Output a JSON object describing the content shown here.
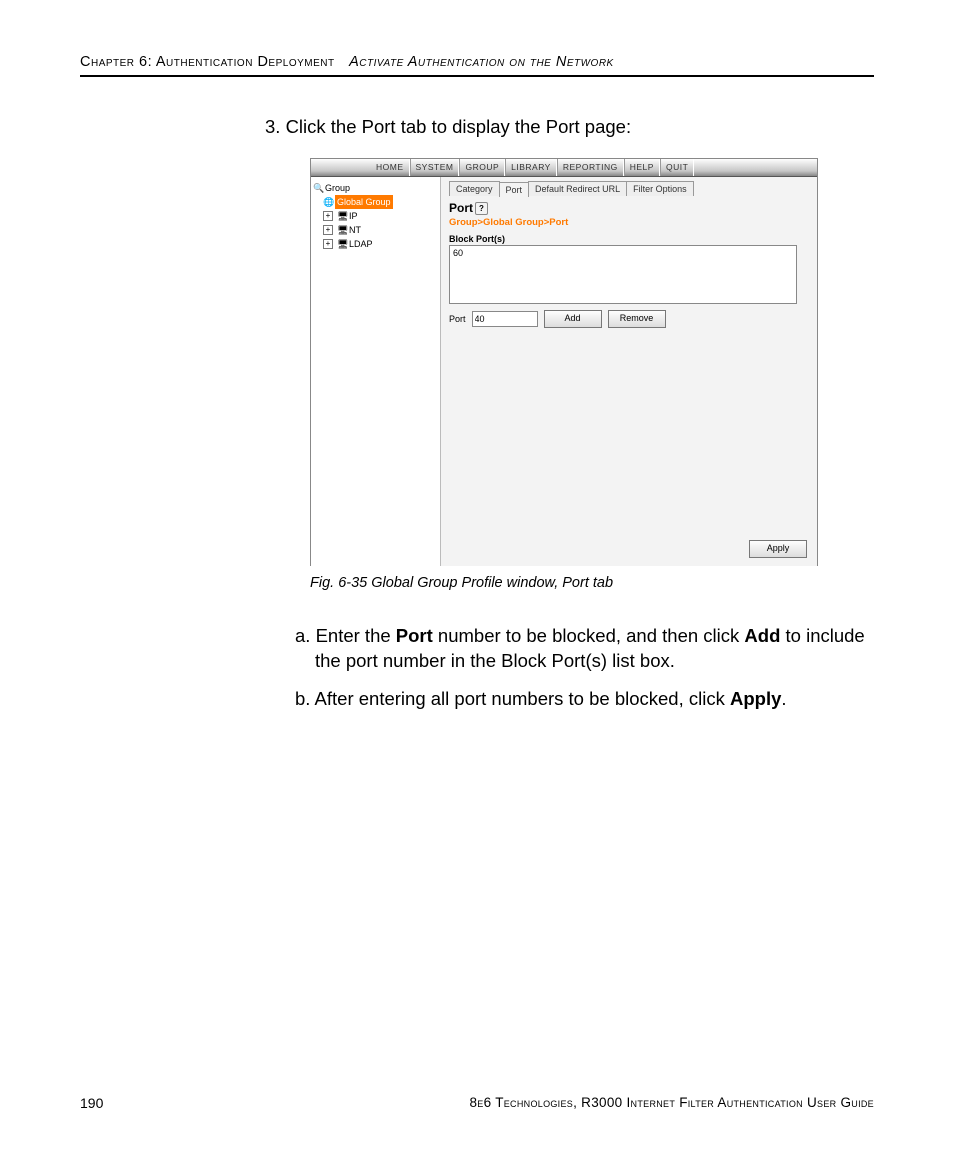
{
  "header": {
    "chapter": "Chapter 6: Authentication Deployment",
    "section": "Activate Authentication on the Network"
  },
  "step_text": "3.  Click the Port tab to display the Port page:",
  "screenshot": {
    "menubar": [
      "HOME",
      "SYSTEM",
      "GROUP",
      "LIBRARY",
      "REPORTING",
      "HELP",
      "QUIT"
    ],
    "tree": {
      "root": "Group",
      "items": [
        {
          "label": "Global Group",
          "selected": true
        },
        {
          "label": "IP"
        },
        {
          "label": "NT"
        },
        {
          "label": "LDAP"
        }
      ]
    },
    "tabs": [
      "Category",
      "Port",
      "Default Redirect URL",
      "Filter Options"
    ],
    "active_tab": 1,
    "panel_title": "Port",
    "breadcrumb": "Group>Global Group>Port",
    "block_label": "Block Port(s)",
    "list_value": "60",
    "port_label": "Port",
    "port_value": "40",
    "add_btn": "Add",
    "remove_btn": "Remove",
    "apply_btn": "Apply"
  },
  "caption": "Fig. 6-35  Global Group Profile window, Port tab",
  "substeps": {
    "a_pre": "a. Enter the ",
    "a_b1": "Port",
    "a_mid": " number to be blocked, and then click ",
    "a_b2": "Add",
    "a_post": " to include the port number in the Block Port(s) list box.",
    "b_pre": "b. After entering all port numbers to be blocked, click ",
    "b_b1": "Apply",
    "b_post": "."
  },
  "footer": {
    "page": "190",
    "right": "8e6 Technologies, R3000 Internet Filter Authentication User Guide"
  }
}
